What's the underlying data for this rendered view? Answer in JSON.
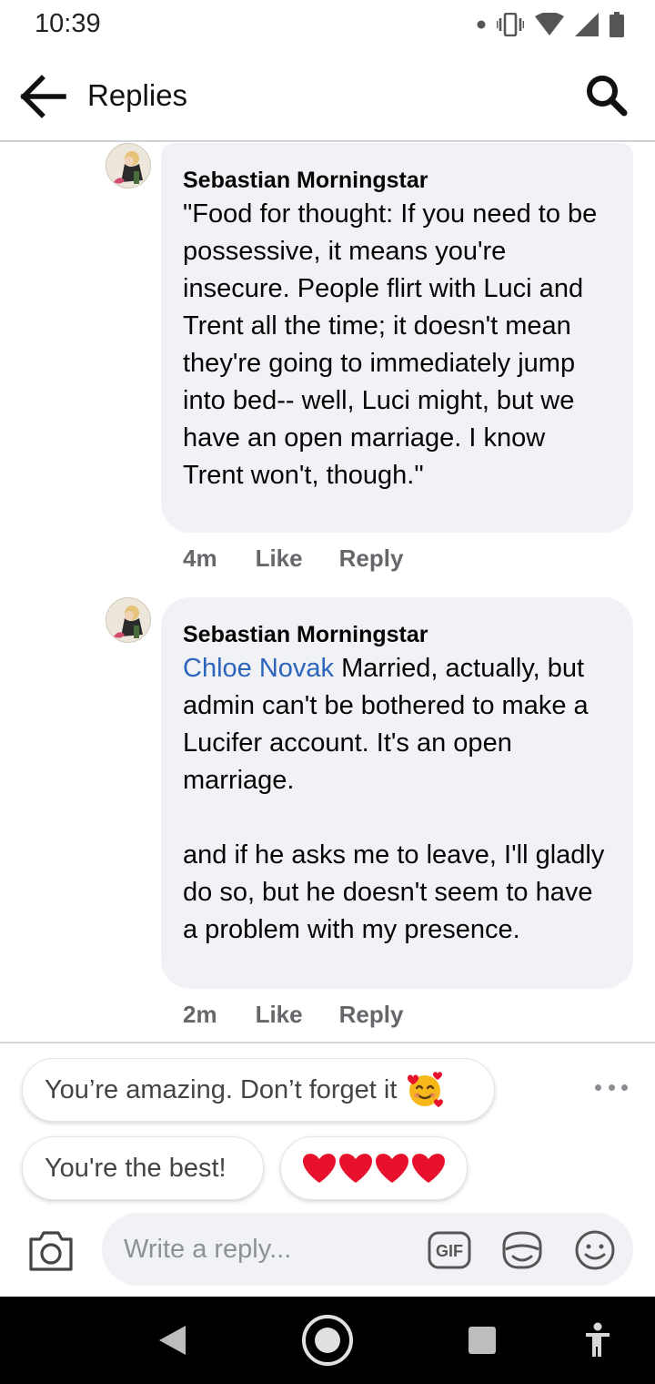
{
  "status_bar": {
    "time": "10:39",
    "icons": [
      "dot-icon",
      "vibrate-icon",
      "wifi-icon",
      "signal-icon",
      "battery-icon"
    ]
  },
  "header": {
    "title": "Replies",
    "back_icon": "arrow-left-icon",
    "search_icon": "search-icon"
  },
  "comments": [
    {
      "author": "Sebastian Morningstar",
      "mention": "",
      "text": "\"Food for thought: If you need to be possessive, it means you're insecure. People flirt with Luci and Trent all the time; it doesn't mean they're going to immediately jump into bed-- well, Luci might, but we have an open marriage. I know Trent won't, though.\"",
      "time": "4m",
      "like_label": "Like",
      "reply_label": "Reply"
    },
    {
      "author": "Sebastian Morningstar",
      "mention": "Chloe Novak",
      "text": " Married, actually, but admin can't be bothered to make a Lucifer account. It's an open marriage.\n\nand if he asks me to leave, I'll gladly do so, but he doesn't seem to have a problem with my presence.",
      "time": "2m",
      "like_label": "Like",
      "reply_label": "Reply"
    }
  ],
  "quick_replies": {
    "items": [
      "You’re amazing. Don’t forget it",
      "You're the best!"
    ],
    "emoji_chip": "hearts",
    "more_icon": "more-dots-icon"
  },
  "composer": {
    "placeholder": "Write a reply...",
    "icons": [
      "camera-icon",
      "gif-icon",
      "sticker-icon",
      "emoji-icon"
    ]
  },
  "colors": {
    "bubble": "#f0f2f5",
    "mention": "#2d64bc",
    "meta": "#65676b",
    "heart": "#e8112d"
  }
}
